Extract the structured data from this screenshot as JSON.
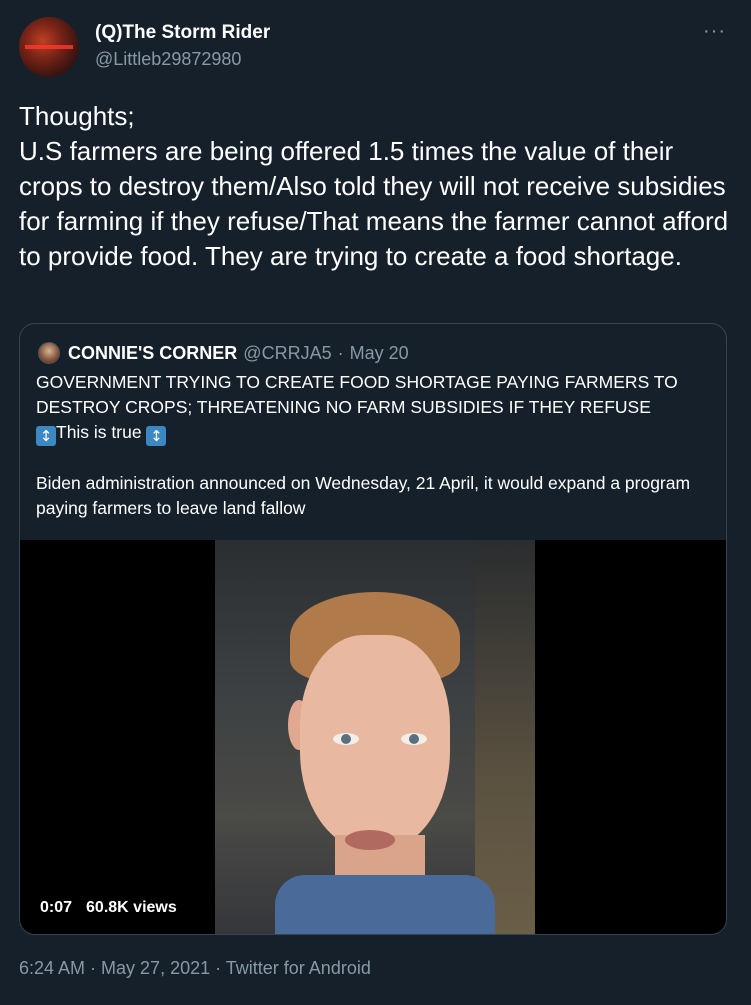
{
  "author": {
    "display_name": "(Q)The Storm Rider",
    "handle": "@Littleb29872980"
  },
  "more_label": "···",
  "tweet_text": "Thoughts;\nU.S farmers are being offered 1.5 times the value of their crops to destroy them/Also told they will not receive subsidies for farming if they refuse/That means the farmer cannot afford to provide food. They are trying to create a food shortage.",
  "quote": {
    "display_name": "CONNIE'S CORNER",
    "handle": "@CRRJA5",
    "separator": "·",
    "date": "May 20",
    "line1": "GOVERNMENT TRYING TO CREATE FOOD SHORTAGE PAYING FARMERS TO DESTROY CROPS; THREATENING NO FARM SUBSIDIES IF THEY REFUSE",
    "line2_emoji": "↕",
    "line2_text": "This is true",
    "line3": "Biden administration announced on Wednesday, 21 April, it would expand a program paying farmers to leave land fallow",
    "video": {
      "duration": "0:07",
      "views": "60.8K views"
    }
  },
  "footer": "6:24 AM · May 27, 2021 · Twitter for Android"
}
